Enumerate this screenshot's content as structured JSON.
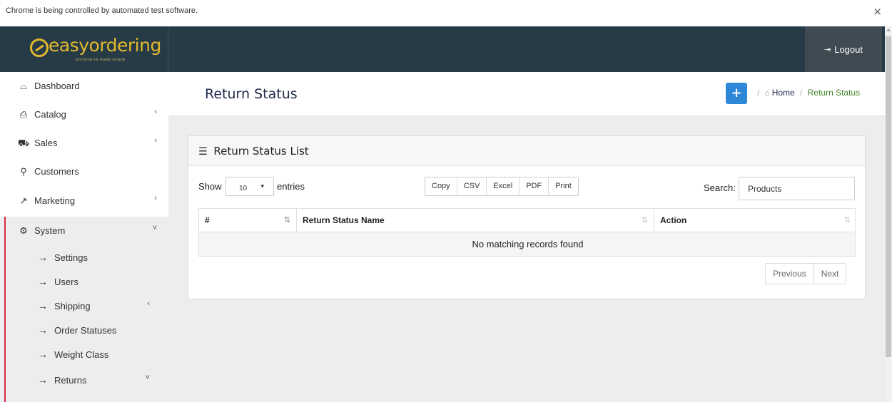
{
  "automation_banner": {
    "text": "Chrome is being controlled by automated test software.",
    "close": "×"
  },
  "header": {
    "logo_text": "easyordering",
    "logo_tagline": "ecommerce made simple",
    "logout_label": "Logout",
    "logout_icon": "sign-out-icon"
  },
  "sidebar": {
    "items": [
      {
        "label": "Dashboard",
        "icon": "dashboard-icon",
        "glyph": "⌓",
        "chevron": ""
      },
      {
        "label": "Catalog",
        "icon": "tag-icon",
        "glyph": "⎙",
        "chevron": "‹"
      },
      {
        "label": "Sales",
        "icon": "cart-icon",
        "glyph": "⛟",
        "chevron": "‹"
      },
      {
        "label": "Customers",
        "icon": "user-icon",
        "glyph": "⚲",
        "chevron": ""
      },
      {
        "label": "Marketing",
        "icon": "share-icon",
        "glyph": "↗",
        "chevron": "‹"
      },
      {
        "label": "System",
        "icon": "gear-icon",
        "glyph": "⚙",
        "chevron": "˅"
      }
    ],
    "sub_items": [
      {
        "label": "Settings",
        "chevron": ""
      },
      {
        "label": "Users",
        "chevron": ""
      },
      {
        "label": "Shipping",
        "chevron": "‹"
      },
      {
        "label": "Order Statuses",
        "chevron": ""
      },
      {
        "label": "Weight Class",
        "chevron": ""
      },
      {
        "label": "Returns",
        "chevron": "˅"
      }
    ],
    "sub_arrow": "→"
  },
  "page": {
    "title": "Return Status",
    "add_button": "+",
    "breadcrumb": {
      "separator": "/",
      "home_icon": "⌂",
      "home": "Home",
      "current": "Return Status"
    }
  },
  "card": {
    "title_icon": "☰",
    "title": "Return Status List",
    "show_label": "Show",
    "length_value": "10",
    "caret": "▾",
    "entries_label": "entries",
    "export_buttons": [
      "Copy",
      "CSV",
      "Excel",
      "PDF",
      "Print"
    ],
    "search_label": "Search:",
    "search_value": "Products",
    "table": {
      "columns": [
        "#",
        "Return Status Name",
        "Action"
      ],
      "sort_icons": [
        "⇅",
        "⇅",
        "⇅"
      ],
      "empty_message": "No matching records found"
    },
    "pagination": {
      "previous": "Previous",
      "next": "Next"
    }
  },
  "colors": {
    "header_bg": "#273b46",
    "logo": "#e0b82e",
    "accent_red": "#d92a44",
    "add_button": "#2f87d8",
    "breadcrumb_current": "#43852a",
    "title_text": "#1f2a4a"
  }
}
